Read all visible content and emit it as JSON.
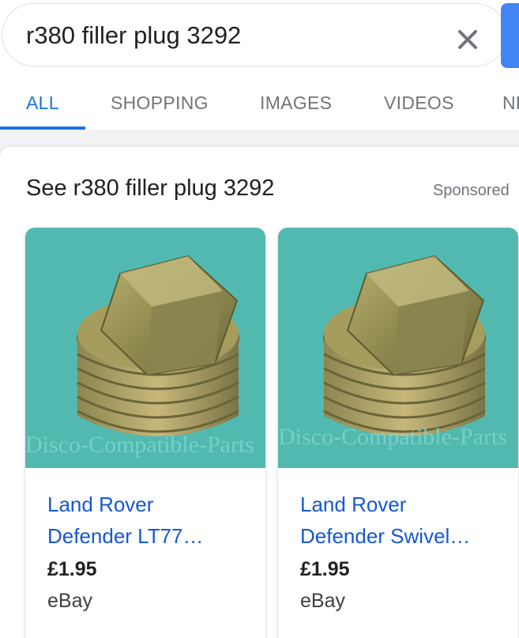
{
  "search": {
    "query": "r380 filler plug 3292",
    "clear_icon": "close-icon"
  },
  "tabs": [
    {
      "label": "ALL",
      "active": true
    },
    {
      "label": "SHOPPING",
      "active": false
    },
    {
      "label": "IMAGES",
      "active": false
    },
    {
      "label": "VIDEOS",
      "active": false
    },
    {
      "label": "NE",
      "active": false
    }
  ],
  "shopping": {
    "title": "See r380 filler plug 3292",
    "sponsored_label": "Sponsored",
    "products": [
      {
        "title_line1": "Land Rover",
        "title_line2": "Defender LT77…",
        "price": "£1.95",
        "seller": "eBay",
        "watermark": "Disco-Compatible-Parts"
      },
      {
        "title_line1": "Land Rover",
        "title_line2": "Defender Swivel…",
        "price": "£1.95",
        "seller": "eBay",
        "watermark": "Disco-Compatible-Parts"
      }
    ]
  },
  "colors": {
    "accent": "#1a73e8",
    "link": "#1558d6",
    "image_background": "#52b9b0",
    "search_button": "#4285f4"
  }
}
